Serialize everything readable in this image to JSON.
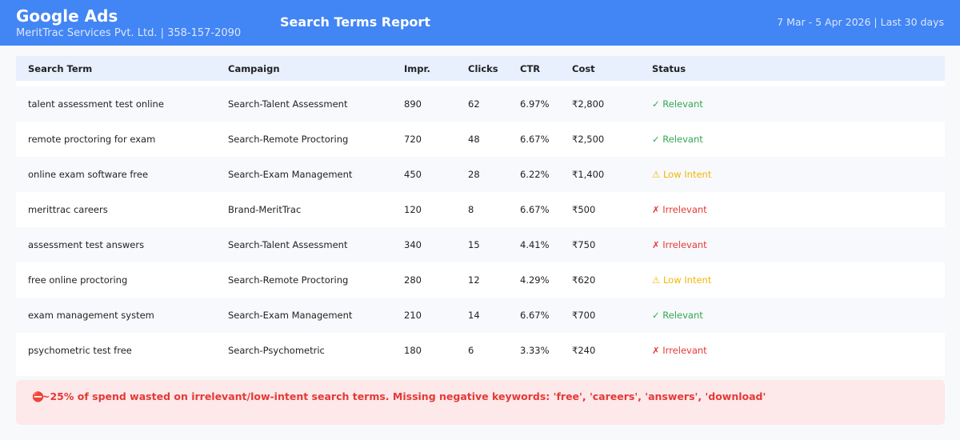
{
  "header": {
    "app_name": "Google Ads",
    "account": "MeritTrac Services Pvt. Ltd. | 358-157-2090",
    "report_title": "Search Terms Report",
    "date_range": "7 Mar - 5 Apr 2026 | Last 30 days"
  },
  "table": {
    "columns": [
      "Search Term",
      "Campaign",
      "Impr.",
      "Clicks",
      "CTR",
      "Cost",
      "Status"
    ],
    "rows": [
      {
        "term": "talent assessment test online",
        "campaign": "Search-Talent Assessment",
        "impr": "890",
        "clicks": "62",
        "ctr": "6.97%",
        "cost": "₹2,800",
        "status": "✓ Relevant",
        "status_type": "relevant"
      },
      {
        "term": "remote proctoring for exam",
        "campaign": "Search-Remote Proctoring",
        "impr": "720",
        "clicks": "48",
        "ctr": "6.67%",
        "cost": "₹2,500",
        "status": "✓ Relevant",
        "status_type": "relevant"
      },
      {
        "term": "online exam software free",
        "campaign": "Search-Exam Management",
        "impr": "450",
        "clicks": "28",
        "ctr": "6.22%",
        "cost": "₹1,400",
        "status": "⚠ Low Intent",
        "status_type": "low"
      },
      {
        "term": "merittrac careers",
        "campaign": "Brand-MeritTrac",
        "impr": "120",
        "clicks": "8",
        "ctr": "6.67%",
        "cost": "₹500",
        "status": "✗ Irrelevant",
        "status_type": "irrelevant"
      },
      {
        "term": "assessment test answers",
        "campaign": "Search-Talent Assessment",
        "impr": "340",
        "clicks": "15",
        "ctr": "4.41%",
        "cost": "₹750",
        "status": "✗ Irrelevant",
        "status_type": "irrelevant"
      },
      {
        "term": "free online proctoring",
        "campaign": "Search-Remote Proctoring",
        "impr": "280",
        "clicks": "12",
        "ctr": "4.29%",
        "cost": "₹620",
        "status": "⚠ Low Intent",
        "status_type": "low"
      },
      {
        "term": "exam management system",
        "campaign": "Search-Exam Management",
        "impr": "210",
        "clicks": "14",
        "ctr": "6.67%",
        "cost": "₹700",
        "status": "✓ Relevant",
        "status_type": "relevant"
      },
      {
        "term": "psychometric test free",
        "campaign": "Search-Psychometric",
        "impr": "180",
        "clicks": "6",
        "ctr": "3.33%",
        "cost": "₹240",
        "status": "✗ Irrelevant",
        "status_type": "irrelevant"
      }
    ]
  },
  "alert": {
    "icon": "warning-icon",
    "icon_glyph": "⛔",
    "text": "~25% of spend wasted on irrelevant/low-intent search terms. Missing negative keywords: 'free', 'careers', 'answers', 'download'"
  },
  "colors": {
    "header_bg": "#4285f4",
    "relevant": "#34a853",
    "low_intent": "#f2b705",
    "irrelevant": "#e53935",
    "alert_bg": "#fde8ea"
  }
}
